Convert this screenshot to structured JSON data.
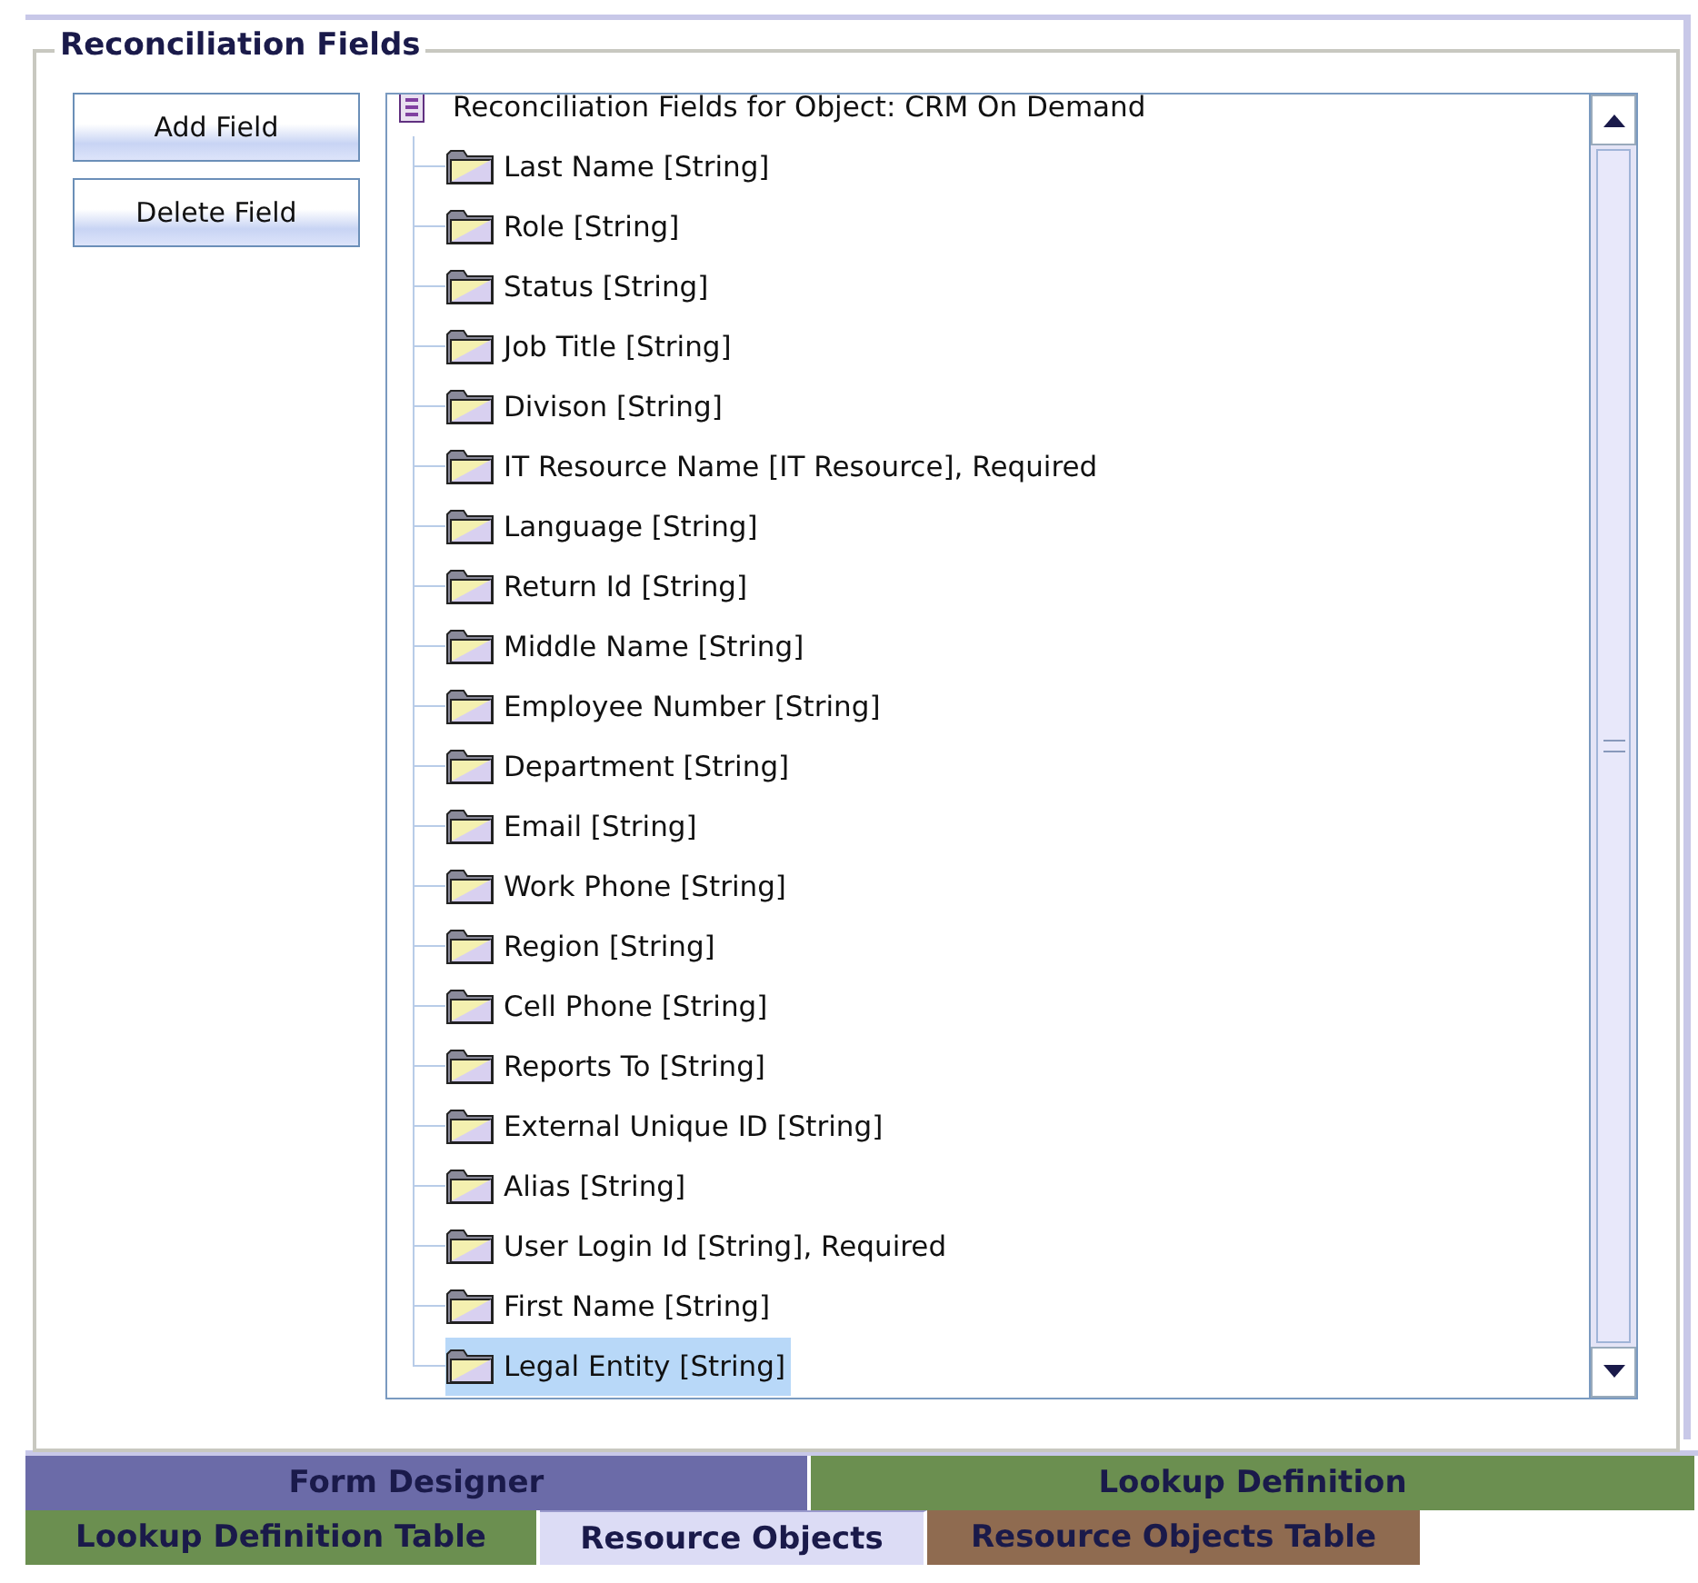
{
  "group": {
    "title": "Reconciliation Fields"
  },
  "buttons": [
    "Add Field",
    "Delete Field"
  ],
  "tree": {
    "root": "Reconciliation Fields for Object: CRM On Demand",
    "children": [
      {
        "label": "Last Name [String]",
        "selected": false
      },
      {
        "label": "Role [String]",
        "selected": false
      },
      {
        "label": "Status [String]",
        "selected": false
      },
      {
        "label": "Job Title [String]",
        "selected": false
      },
      {
        "label": "Divison [String]",
        "selected": false
      },
      {
        "label": "IT Resource Name [IT Resource], Required",
        "selected": false
      },
      {
        "label": "Language [String]",
        "selected": false
      },
      {
        "label": "Return Id [String]",
        "selected": false
      },
      {
        "label": "Middle Name [String]",
        "selected": false
      },
      {
        "label": "Employee Number [String]",
        "selected": false
      },
      {
        "label": "Department [String]",
        "selected": false
      },
      {
        "label": "Email [String]",
        "selected": false
      },
      {
        "label": "Work Phone [String]",
        "selected": false
      },
      {
        "label": "Region [String]",
        "selected": false
      },
      {
        "label": "Cell Phone [String]",
        "selected": false
      },
      {
        "label": "Reports To [String]",
        "selected": false
      },
      {
        "label": "External Unique ID [String]",
        "selected": false
      },
      {
        "label": "Alias [String]",
        "selected": false
      },
      {
        "label": "User Login Id [String], Required",
        "selected": false
      },
      {
        "label": "First Name [String]",
        "selected": false
      },
      {
        "label": "Legal Entity [String]",
        "selected": true
      }
    ]
  },
  "tab_rows": [
    [
      {
        "label": "Form Designer",
        "color": "#6b6ba8",
        "selected": false
      },
      {
        "label": "Lookup Definition",
        "color": "#6b8f50",
        "selected": false
      }
    ],
    [
      {
        "label": "Lookup Definition Table",
        "color": "#6b8f50",
        "selected": false
      },
      {
        "label": "Resource Objects",
        "color": "#dcdcf5",
        "selected": true
      },
      {
        "label": "Resource Objects Table",
        "color": "#8f6b50",
        "selected": false
      }
    ]
  ]
}
